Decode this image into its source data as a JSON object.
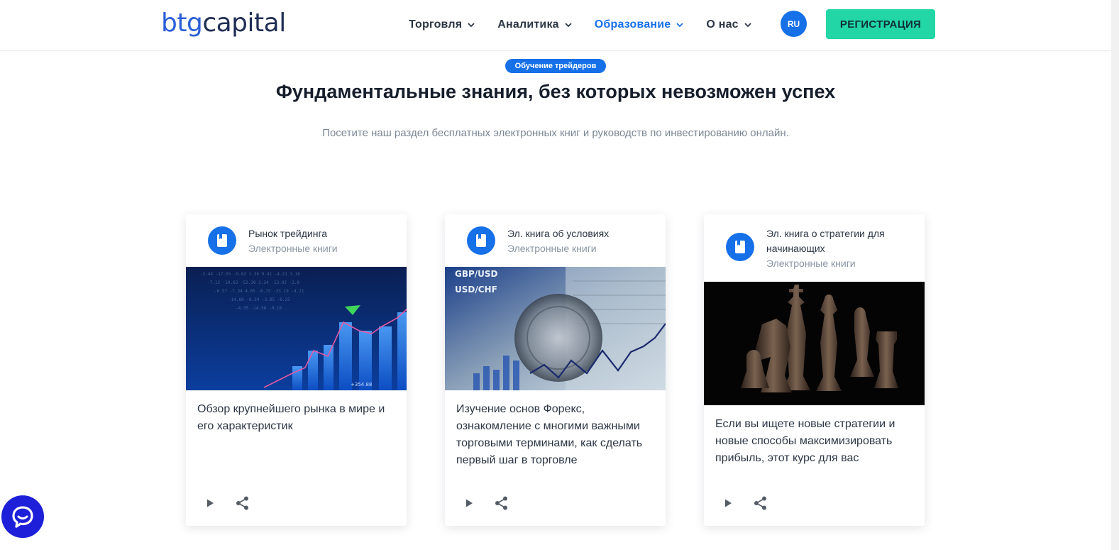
{
  "header": {
    "logo_part1": "btg",
    "logo_part2": "capital",
    "nav": [
      {
        "label": "Торговля",
        "active": false
      },
      {
        "label": "Аналитика",
        "active": false
      },
      {
        "label": "Образование",
        "active": true
      },
      {
        "label": "О нас",
        "active": false
      }
    ],
    "language": "RU",
    "register_label": "РЕГИСТРАЦИЯ"
  },
  "hero": {
    "badge": "Обучение трейдеров",
    "title": "Фундаментальные знания, без которых невозможен успех",
    "subtitle": "Посетите наш раздел бесплатных электронных книг и руководств по инвестированию онлайн."
  },
  "cards": [
    {
      "title": "Рынок трейдинга",
      "category": "Электронные книги",
      "description": "Обзор крупнейшего рынка в мире и его характеристик",
      "image_label": "+354.88",
      "icon": "book-icon"
    },
    {
      "title": "Эл. книга об условиях",
      "category": "Электронные книги",
      "description": "Изучение основ Форекс, ознакомление с многими важными торговыми терминами, как сделать первый шаг в торговле",
      "image_labels": [
        "GBP/USD",
        "USD/CHF"
      ],
      "icon": "book-icon"
    },
    {
      "title": "Эл. книга о стратегии для начинающих",
      "category": "Электронные книги",
      "description": "Если вы ищете новые стратегии и новые способы максимизировать прибыль, этот курс для вас",
      "icon": "book-icon"
    }
  ],
  "colors": {
    "primary": "#1670e8",
    "accent": "#22d6a5",
    "chat": "#1d20d8"
  }
}
